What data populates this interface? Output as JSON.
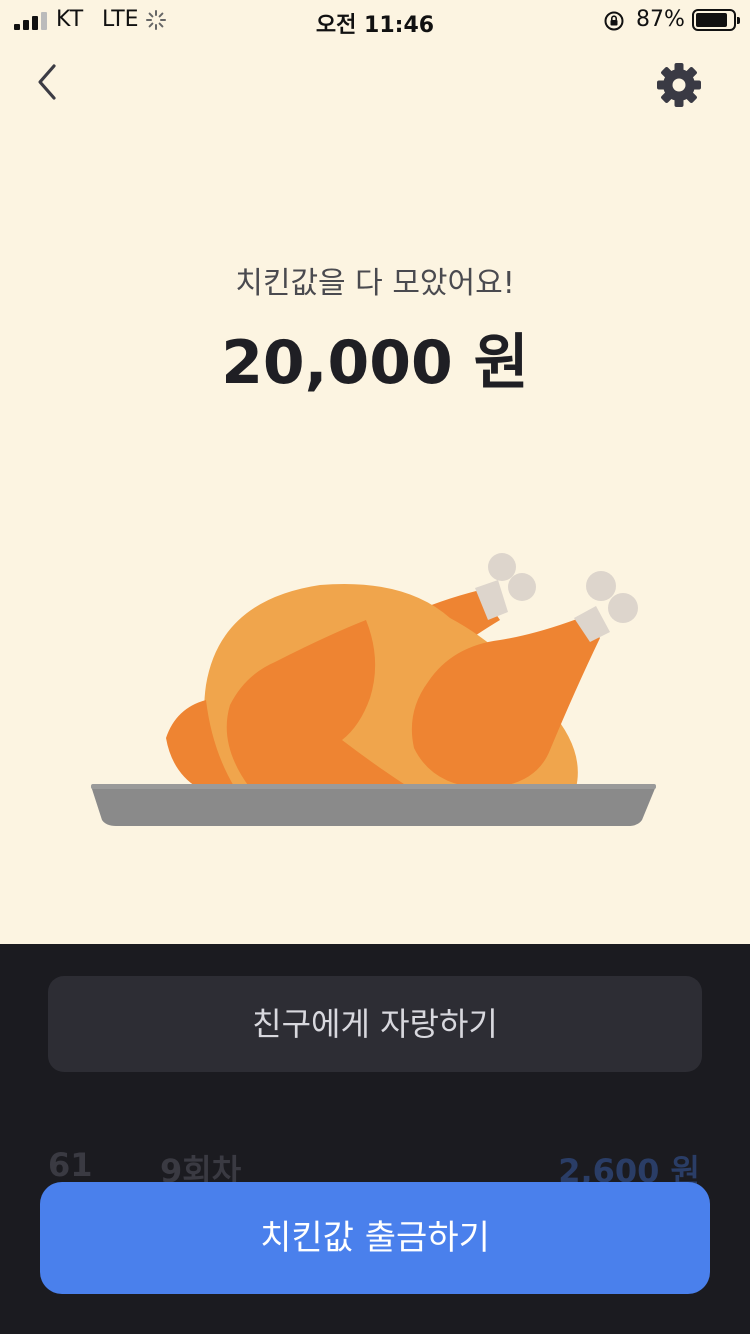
{
  "status_bar": {
    "carrier": "KT",
    "network": "LTE",
    "time": "오전 11:46",
    "battery_percent": "87%",
    "battery_level": 0.87
  },
  "header": {
    "back_icon": "chevron-left-icon",
    "settings_icon": "gear-icon"
  },
  "main": {
    "headline": "치킨값을 다 모았어요!",
    "amount": "20,000 원",
    "illustration": "roast-chicken-on-tray"
  },
  "actions": {
    "share_label": "친구에게 자랑하기",
    "withdraw_label": "치킨값 출금하기"
  },
  "history": {
    "rows": [
      {
        "no": "61",
        "round": "9회차",
        "amount": "2,600 원"
      }
    ]
  },
  "colors": {
    "top_background": "#fcf4e1",
    "bottom_background": "#1b1b20",
    "primary_button": "#4a80ec",
    "secondary_button": "#2d2d34",
    "chicken_light": "#f0a54c",
    "chicken_dark": "#ee8432",
    "bone": "#ddd5cc",
    "tray": "#8a8a8a"
  }
}
